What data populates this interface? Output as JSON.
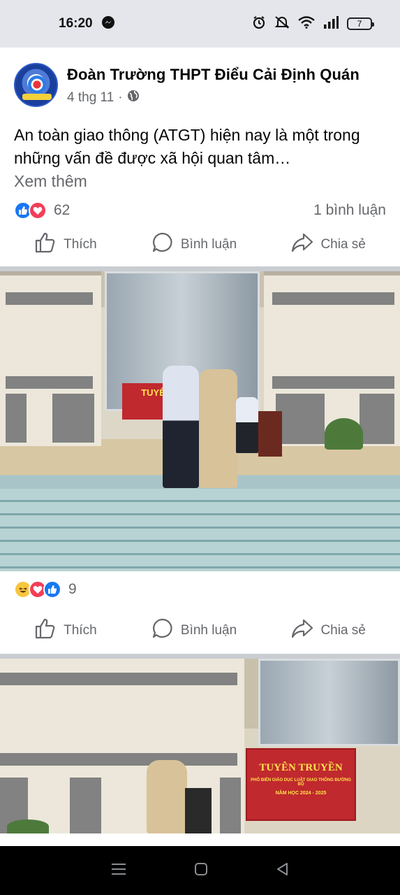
{
  "status_bar": {
    "time": "16:20",
    "battery": "7",
    "icons": [
      "messenger-icon",
      "alarm-icon",
      "mute-icon",
      "wifi-icon",
      "signal-icon"
    ]
  },
  "post": {
    "page_name": "Đoàn Trường THPT Điểu Cải Định Quán",
    "date": "4 thg 11",
    "separator": "·",
    "text": "An toàn giao thông (ATGT) hiện nay là một trong những vấn đề được xã hội quan tâm…",
    "see_more": "Xem thêm",
    "reaction_count": "62",
    "comment_count": "1 bình luận",
    "actions": {
      "like": "Thích",
      "comment": "Bình luận",
      "share": "Chia sẻ"
    }
  },
  "photo1": {
    "banner_text": "TUYÊN T",
    "reaction_count": "9"
  },
  "photo2": {
    "banner_title": "TUYÊN TRUYỀN",
    "banner_subtitle": "PHỔ BIẾN GIÁO DỤC LUẬT GIAO THÔNG ĐƯỜNG BỘ",
    "banner_year": "NĂM HỌC 2024 - 2025"
  },
  "colors": {
    "facebook_blue": "#1877f2",
    "love_red": "#f33e58",
    "secondary_text": "#65676b"
  }
}
